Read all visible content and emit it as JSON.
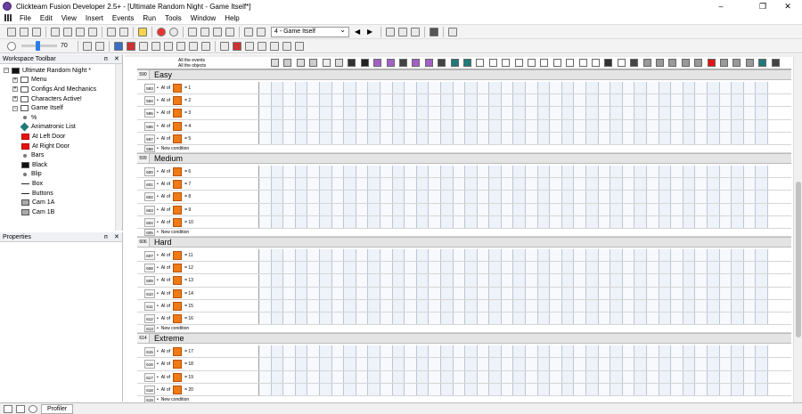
{
  "window": {
    "title": "Clickteam Fusion Developer 2.5+ - [Ultimate Random Night - Game Itself*]",
    "minimize_label": "–",
    "maximize_label": "❐",
    "close_label": "✕"
  },
  "menu": {
    "items": [
      "File",
      "Edit",
      "View",
      "Insert",
      "Events",
      "Run",
      "Tools",
      "Window",
      "Help"
    ]
  },
  "toolbar": {
    "frame_selected": "4 - Game Itself",
    "zoom_value": "70",
    "zoom_fraction": 0.45
  },
  "workspace": {
    "title": "Workspace Toolbar",
    "pin_label": "ᴨ",
    "close_label": "✕",
    "tree": [
      {
        "label": "Ultimate Random Night *",
        "indent": 0,
        "icon": "app-icon"
      },
      {
        "label": "Menu",
        "indent": 1,
        "icon": "frame-icon"
      },
      {
        "label": "Configs And Mechanics",
        "indent": 1,
        "icon": "frame-icon"
      },
      {
        "label": "Characters Active!",
        "indent": 1,
        "icon": "frame-icon"
      },
      {
        "label": "Game Itself",
        "indent": 1,
        "icon": "frame-icon"
      },
      {
        "label": "%",
        "indent": 2,
        "icon": "dot-icon"
      },
      {
        "label": "Animatronic List",
        "indent": 2,
        "icon": "diamond-icon"
      },
      {
        "label": "At Left Door",
        "indent": 2,
        "icon": "red-square-icon"
      },
      {
        "label": "At Right Door",
        "indent": 2,
        "icon": "red-square-icon"
      },
      {
        "label": "Bars",
        "indent": 2,
        "icon": "dot-icon"
      },
      {
        "label": "Black",
        "indent": 2,
        "icon": "black-square-icon"
      },
      {
        "label": "Blip",
        "indent": 2,
        "icon": "dot-icon"
      },
      {
        "label": "Box",
        "indent": 2,
        "icon": "line-icon"
      },
      {
        "label": "Buttons",
        "indent": 2,
        "icon": "dash-icon"
      },
      {
        "label": "Cam 1A",
        "indent": 2,
        "icon": "gray-square-icon"
      },
      {
        "label": "Cam 1B",
        "indent": 2,
        "icon": "gray-square-icon"
      }
    ]
  },
  "properties": {
    "title": "Properties",
    "pin_label": "ᴨ",
    "close_label": "✕"
  },
  "status": {
    "profiler_label": "Profiler"
  },
  "event_editor": {
    "header_all_events": "All the events",
    "header_all_objects": "All the objects",
    "groups": [
      {
        "number": "590",
        "name": "Easy",
        "events": [
          {
            "number": "593",
            "prefix": "AI of",
            "op": "= 1"
          },
          {
            "number": "594",
            "prefix": "AI of",
            "op": "= 2"
          },
          {
            "number": "595",
            "prefix": "AI of",
            "op": "= 3"
          },
          {
            "number": "596",
            "prefix": "AI of",
            "op": "= 4"
          },
          {
            "number": "597",
            "prefix": "AI of",
            "op": "= 5"
          }
        ],
        "new_number": "598"
      },
      {
        "number": "599",
        "name": "Medium",
        "events": [
          {
            "number": "600",
            "prefix": "AI of",
            "op": "= 6"
          },
          {
            "number": "601",
            "prefix": "AI of",
            "op": "= 7"
          },
          {
            "number": "602",
            "prefix": "AI of",
            "op": "= 8"
          },
          {
            "number": "603",
            "prefix": "AI of",
            "op": "= 9"
          },
          {
            "number": "604",
            "prefix": "AI of",
            "op": "= 10"
          }
        ],
        "new_number": "605"
      },
      {
        "number": "606",
        "name": "Hard",
        "events": [
          {
            "number": "607",
            "prefix": "AI of",
            "op": "= 11"
          },
          {
            "number": "608",
            "prefix": "AI of",
            "op": "= 12"
          },
          {
            "number": "609",
            "prefix": "AI of",
            "op": "= 13"
          },
          {
            "number": "610",
            "prefix": "AI of",
            "op": "= 14"
          },
          {
            "number": "611",
            "prefix": "AI of",
            "op": "= 15"
          },
          {
            "number": "612",
            "prefix": "AI of",
            "op": "= 16"
          }
        ],
        "new_number": "613"
      },
      {
        "number": "614",
        "name": "Extreme",
        "events": [
          {
            "number": "615",
            "prefix": "AI of",
            "op": "= 17"
          },
          {
            "number": "616",
            "prefix": "AI of",
            "op": "= 18"
          },
          {
            "number": "617",
            "prefix": "AI of",
            "op": "= 19"
          },
          {
            "number": "618",
            "prefix": "AI of",
            "op": "= 20"
          }
        ],
        "new_number": "619"
      }
    ],
    "new_condition_label": "New condition",
    "colors": {
      "object_orange": "#f07a16",
      "cell_blue": "#eef2f9"
    }
  }
}
